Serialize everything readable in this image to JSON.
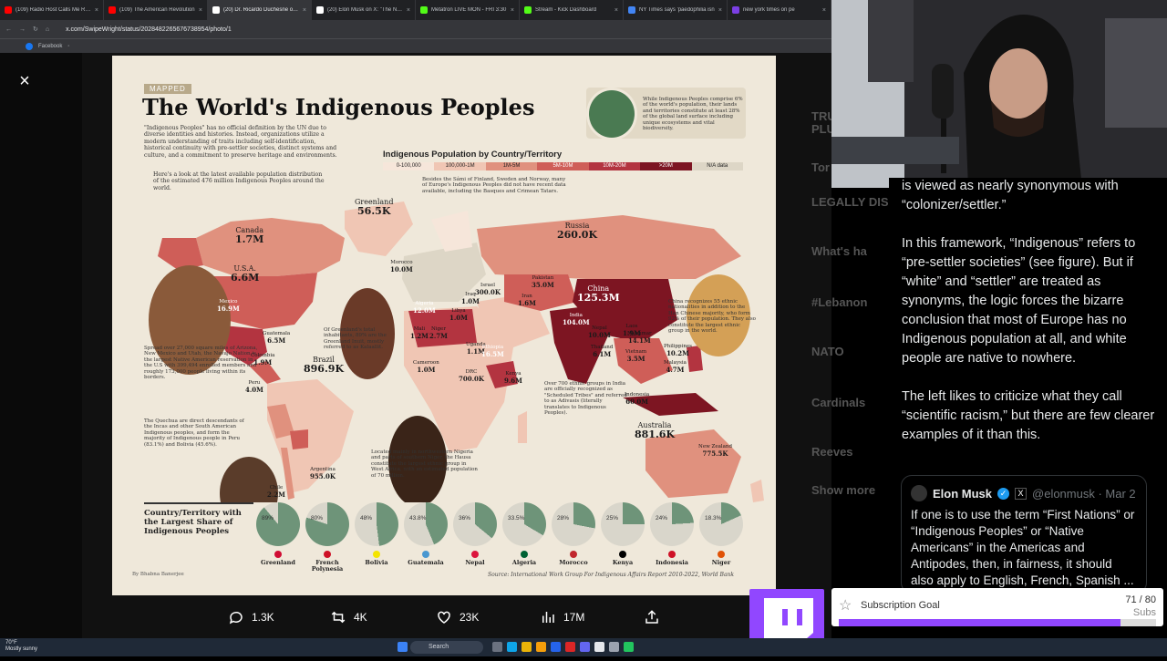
{
  "browser": {
    "tabs": [
      {
        "label": "(109) Radio Host Calls Me Racis",
        "color": "#ff0000"
      },
      {
        "label": "(109) The American Revolution",
        "color": "#ff0000"
      },
      {
        "label": "(20) Dr. Ricardo Duchesne on X",
        "color": "#ffffff"
      },
      {
        "label": "(20) Elon Musk on X: \"The New",
        "color": "#ffffff"
      },
      {
        "label": "Metatron LIVE MON - FRI 3:30",
        "color": "#53fc18"
      },
      {
        "label": "Stream - Kick Dashboard",
        "color": "#53fc18"
      },
      {
        "label": "NY Times says 'paedophilia isn",
        "color": "#4285f4"
      },
      {
        "label": "new york times on pe",
        "color": "#7b3fe4"
      }
    ],
    "url": "x.com/SwipeWright/status/2028482265676738954/photo/1",
    "bookmark": "Facebook"
  },
  "viewer": {
    "close_icon": "×"
  },
  "infographic": {
    "tag": "MAPPED",
    "title": "The World's Indigenous Peoples",
    "intro": "\"Indigenous Peoples\" has no official definition by the UN due to diverse identities and histories. Instead, organizations utilize a modern understanding of traits including self-identification, historical continuity with pre-settler societies, distinct systems and culture, and a commitment to preserve heritage and environments.",
    "intro2": "Here's a look at the latest available population distribution of the estimated 476 million Indigenous Peoples around the world.",
    "topnote": "While Indigenous Peoples comprise 6% of the world's population, their lands and territories constitute at least 28% of the global land surface including unique ecosystems and vital biodiversity.",
    "legend_title": "Indigenous Population by Country/Territory",
    "legend": [
      {
        "label": "0-100,000",
        "color": "#f6e6da"
      },
      {
        "label": "100,000-1M",
        "color": "#f0c6b4"
      },
      {
        "label": "1M-5M",
        "color": "#e0917e"
      },
      {
        "label": "5M-10M",
        "color": "#cf5e58"
      },
      {
        "label": "10M-20M",
        "color": "#b33440"
      },
      {
        "label": ">20M",
        "color": "#7d1522"
      },
      {
        "label": "N/A data",
        "color": "#ddd6c6"
      }
    ],
    "countries": [
      {
        "name": "Greenland",
        "value": "56.5K"
      },
      {
        "name": "Canada",
        "value": "1.7M"
      },
      {
        "name": "U.S.A.",
        "value": "6.6M"
      },
      {
        "name": "Mexico",
        "value": "16.9M"
      },
      {
        "name": "Guatemala",
        "value": "6.5M"
      },
      {
        "name": "Colombia",
        "value": "1.9M"
      },
      {
        "name": "Peru",
        "value": "4.0M"
      },
      {
        "name": "Brazil",
        "value": "896.9K"
      },
      {
        "name": "Argentina",
        "value": "955.0K"
      },
      {
        "name": "Chile",
        "value": "2.2M"
      },
      {
        "name": "Morocco",
        "value": "10.0M"
      },
      {
        "name": "Algeria",
        "value": "12.0M"
      },
      {
        "name": "Libya",
        "value": "1.0M"
      },
      {
        "name": "Mali",
        "value": "1.2M"
      },
      {
        "name": "Niger",
        "value": "2.7M"
      },
      {
        "name": "Cameroon",
        "value": "1.0M"
      },
      {
        "name": "Uganda",
        "value": "1.1M"
      },
      {
        "name": "Ethiopia",
        "value": "16.5M"
      },
      {
        "name": "DRC",
        "value": "700.0K"
      },
      {
        "name": "Kenya",
        "value": "9.6M"
      },
      {
        "name": "Russia",
        "value": "260.0K"
      },
      {
        "name": "Iran",
        "value": "1.6M"
      },
      {
        "name": "Pakistan",
        "value": "35.0M"
      },
      {
        "name": "Iraq",
        "value": "1.0M"
      },
      {
        "name": "Israel",
        "value": "300.0K"
      },
      {
        "name": "India",
        "value": "104.0M"
      },
      {
        "name": "Nepal",
        "value": "10.0M"
      },
      {
        "name": "China",
        "value": "125.3M"
      },
      {
        "name": "Myanmar",
        "value": "14.1M"
      },
      {
        "name": "Thailand",
        "value": "6.1M"
      },
      {
        "name": "Laos",
        "value": "1.9M"
      },
      {
        "name": "Vietnam",
        "value": "3.5M"
      },
      {
        "name": "Philippines",
        "value": "10.2M"
      },
      {
        "name": "Malaysia",
        "value": "4.7M"
      },
      {
        "name": "Indonesia",
        "value": "60.0M"
      },
      {
        "name": "Australia",
        "value": "881.6K"
      },
      {
        "name": "New Zealand",
        "value": "775.5K"
      }
    ],
    "notes": {
      "navajo": "Spread over 27,000 square miles of Arizona, New Mexico and Utah, the Navajo Nation is the largest Native American reservation in the U.S with 399,494 enrolled members and roughly 173,000 people living within its borders.",
      "greenland": "Of Greenland's total inhabitants, 89% are the Greenland Inuit, mostly referred to as Kalaallit.",
      "sami": "Besides the Sámi of Finland, Sweden and Norway, many of Europe's Indigenous Peoples did not have recent data available, including the Basques and Crimean Tatars.",
      "china": "China recognizes 55 ethnic nationalities in addition to the Han Chinese majority, who form 92% of their population. They also constitute the largest ethnic group in the world.",
      "quechua": "The Quechua are direct descendants of the Incas and other South American Indigenous peoples, and form the majority of Indigenous people in Peru (83.1%) and Bolivia (45.6%).",
      "hausa": "Located mainly in northwestern Nigeria and parts of southern Niger, the Hausa constitute the largest ethnic group in West Africa, with an estimated population of 70 million.",
      "india": "Over 700 ethnic groups in India are officially recognized as \"Scheduled Tribes\" and referred to as Adivasis (literally translates to Indigenous Peoples)."
    },
    "share_title": "Country/Territory with the Largest Share of Indigenous Peoples",
    "shares": [
      {
        "pct": 89,
        "label": "89%",
        "name": "Greenland",
        "flag": "#d00c33"
      },
      {
        "pct": 80,
        "label": "80%",
        "name": "French Polynesia",
        "flag": "#ce1126"
      },
      {
        "pct": 48,
        "label": "48%",
        "name": "Bolivia",
        "flag": "#f4e400"
      },
      {
        "pct": 43.8,
        "label": "43.8%",
        "name": "Guatemala",
        "flag": "#4997d0"
      },
      {
        "pct": 36,
        "label": "36%",
        "name": "Nepal",
        "flag": "#dc143c"
      },
      {
        "pct": 33.5,
        "label": "33.5%",
        "name": "Algeria",
        "flag": "#006233"
      },
      {
        "pct": 28,
        "label": "28%",
        "name": "Morocco",
        "flag": "#c1272d"
      },
      {
        "pct": 25,
        "label": "25%",
        "name": "Kenya",
        "flag": "#000000"
      },
      {
        "pct": 24,
        "label": "24%",
        "name": "Indonesia",
        "flag": "#ce1126"
      },
      {
        "pct": 18.3,
        "label": "18.3%",
        "name": "Niger",
        "flag": "#e05206"
      }
    ],
    "byline": "By Bhabna Banerjee",
    "source": "Source: International Work Group For Indigenous Affairs Report 2010-2022, World Bank"
  },
  "actions": {
    "replies": "1.3K",
    "reposts": "4K",
    "likes": "23K",
    "views": "17M"
  },
  "tweet": {
    "line0": "is viewed as nearly synonymous with “colonizer/settler.”",
    "p1": "In this framework, “Indigenous” refers to “pre-settler societies” (see figure). But if “white” and “settler” are treated as synonyms, the logic forces the bizarre conclusion that most of Europe has no Indigenous population at all, and white people are native to nowhere.",
    "p2": "The left likes to criticize what they call “scientific racism,” but there are few clearer examples of it than this.",
    "quote": {
      "name": "Elon Musk",
      "handle": "@elonmusk · Mar 2",
      "text": "If one is to use the term “First Nations” or “Indigenous Peoples” or “Native Americans” in the Americas and Antipodes, then, in fairness, it should also apply to English, French, Spanish ..."
    }
  },
  "side_dim": [
    "TRU",
    "PLU",
    "Tor",
    "LEGALLY DIS",
    "What's ha",
    "#Lebanon",
    "NATO",
    "Cardinals",
    "Reeves",
    "Show more"
  ],
  "subgoal": {
    "label": "Subscription Goal",
    "current": "71",
    "target": "80",
    "count": "71 / 80",
    "unit": "Subs",
    "progress": 0.8875
  },
  "taskbar": {
    "temp": "70°F",
    "weather": "Mostly sunny",
    "search": "Search"
  }
}
